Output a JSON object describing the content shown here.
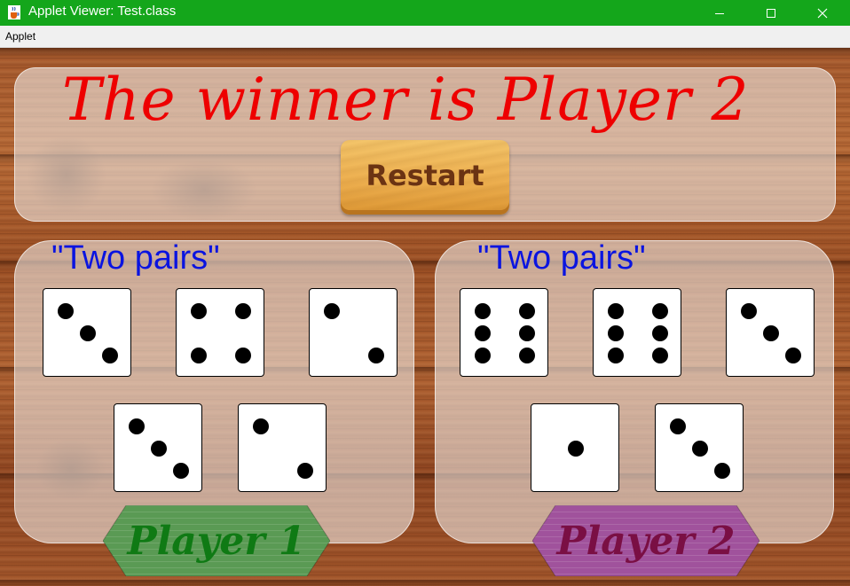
{
  "window": {
    "title": "Applet Viewer: Test.class",
    "icon": "java-cup-icon"
  },
  "menu": {
    "items": [
      "Applet"
    ]
  },
  "game": {
    "winner_text": "The winner is Player 2",
    "restart_label": "Restart",
    "players": [
      {
        "name": "Player 1",
        "hand": "\"Two pairs\"",
        "dice": [
          3,
          4,
          2,
          3,
          2
        ],
        "button_color": "#5a9a54",
        "label_color": "#0f7a14"
      },
      {
        "name": "Player 2",
        "hand": "\"Two pairs\"",
        "dice": [
          6,
          6,
          3,
          1,
          3
        ],
        "button_color": "#a0529c",
        "label_color": "#7a0f44"
      }
    ]
  },
  "colors": {
    "titlebar": "#14a61b",
    "winner_text": "#ee0000",
    "hand_text": "#0a14e0"
  }
}
